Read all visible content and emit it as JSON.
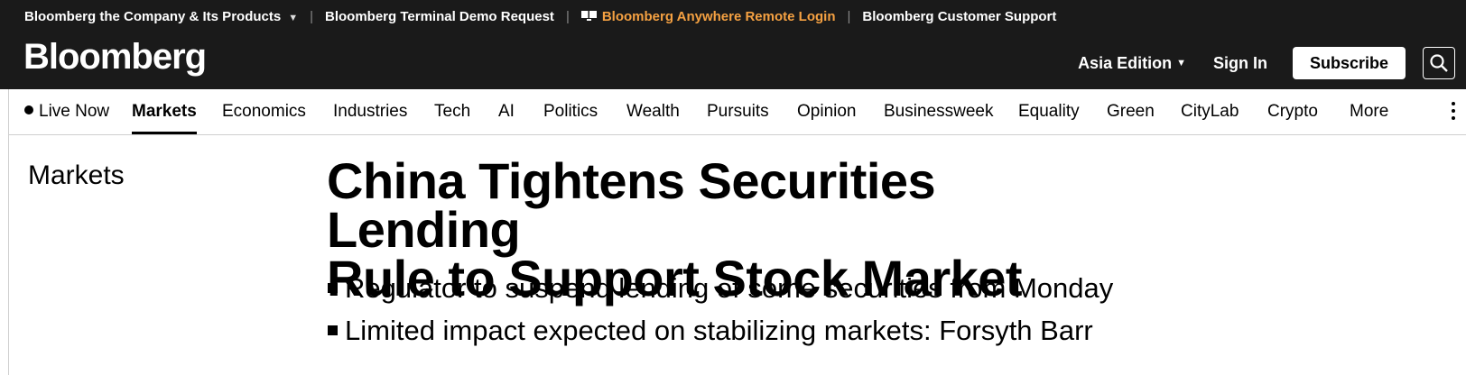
{
  "topbar": {
    "company_link": "Bloomberg the Company & Its Products",
    "demo_link": "Bloomberg Terminal Demo Request",
    "anywhere_link": "Bloomberg Anywhere Remote Login",
    "support_link": "Bloomberg Customer Support",
    "anywhere_color": "#f5a142"
  },
  "header": {
    "logo": "Bloomberg",
    "edition": "Asia Edition",
    "signin": "Sign In",
    "subscribe": "Subscribe"
  },
  "nav": {
    "live": "Live Now",
    "items": [
      "Markets",
      "Economics",
      "Industries",
      "Tech",
      "AI",
      "Politics",
      "Wealth",
      "Pursuits",
      "Opinion",
      "Businessweek",
      "Equality",
      "Green",
      "CityLab",
      "Crypto",
      "More"
    ],
    "active": "Markets"
  },
  "article": {
    "section": "Markets",
    "headline_line1": "China Tightens Securities Lending",
    "headline_line2": "Rule to Support Stock Market",
    "bullets": [
      "Regulator to suspend lending of some securities from Monday",
      "Limited impact expected on stabilizing markets: Forsyth Barr"
    ]
  }
}
